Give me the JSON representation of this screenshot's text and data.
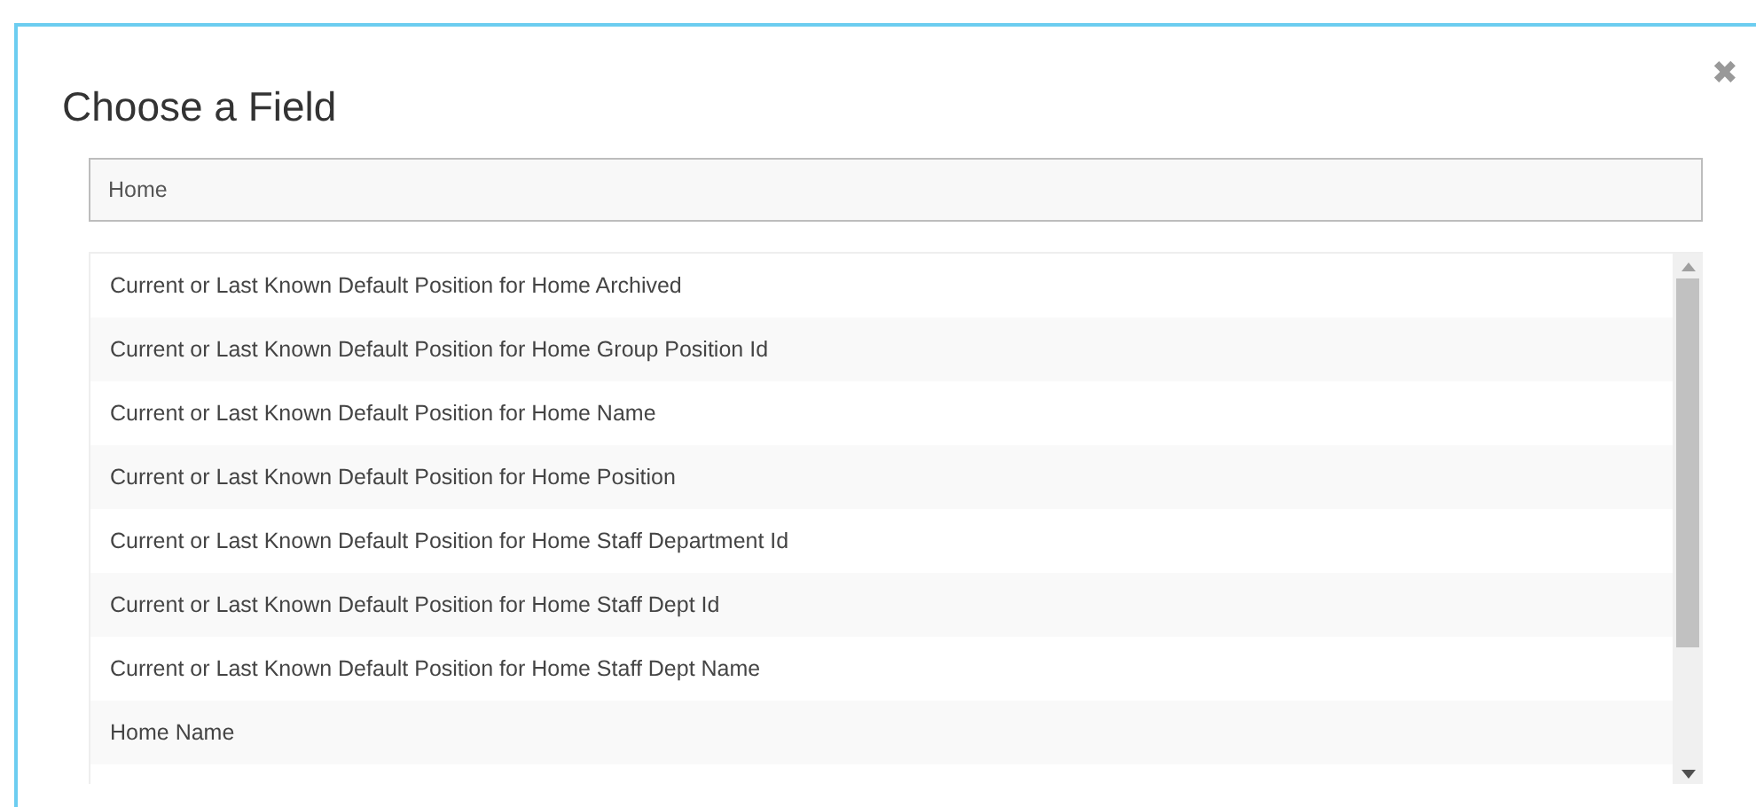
{
  "dialog": {
    "title": "Choose a Field",
    "close": "✖"
  },
  "search": {
    "value": "Home"
  },
  "fields": [
    {
      "label": "Current or Last Known Default Position for Home Archived"
    },
    {
      "label": "Current or Last Known Default Position for Home Group Position Id"
    },
    {
      "label": "Current or Last Known Default Position for Home Name"
    },
    {
      "label": "Current or Last Known Default Position for Home Position"
    },
    {
      "label": "Current or Last Known Default Position for Home Staff Department Id"
    },
    {
      "label": "Current or Last Known Default Position for Home Staff Dept Id"
    },
    {
      "label": "Current or Last Known Default Position for Home Staff Dept Name"
    },
    {
      "label": "Home Name"
    }
  ]
}
